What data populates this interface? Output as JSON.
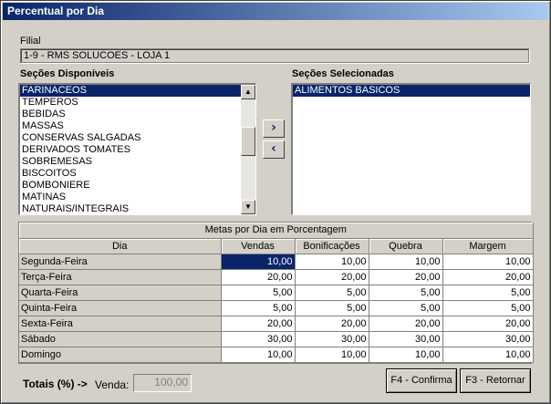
{
  "window": {
    "title": "Percentual por Dia"
  },
  "filial": {
    "label": "Filial",
    "value": "1-9 - RMS SOLUCOES - LOJA 1"
  },
  "secoes_disponiveis": {
    "label": "Seções Disponíveis",
    "items": [
      "FARINACEOS",
      "TEMPEROS",
      "BEBIDAS",
      "MASSAS",
      "CONSERVAS SALGADAS",
      "DERIVADOS TOMATES",
      "SOBREMESAS",
      "BISCOITOS",
      "BOMBONIERE",
      "MATINAS",
      "NATURAIS/INTEGRAIS"
    ],
    "selected_index": 0
  },
  "secoes_selecionadas": {
    "label": "Seções Selecionadas",
    "items": [
      "ALIMENTOS BASICOS"
    ],
    "selected_index": 0
  },
  "buttons": {
    "add": "›",
    "remove": "‹",
    "confirma": "F4 - Confirma",
    "retornar": "F3 - Retornar"
  },
  "grid": {
    "title": "Metas por Dia em Porcentagem",
    "columns": [
      "Dia",
      "Vendas",
      "Bonificações",
      "Quebra",
      "Margem"
    ],
    "rows": [
      {
        "dia": "Segunda-Feira",
        "vendas": "10,00",
        "bonif": "10,00",
        "quebra": "10,00",
        "margem": "10,00"
      },
      {
        "dia": "Terça-Feira",
        "vendas": "20,00",
        "bonif": "20,00",
        "quebra": "20,00",
        "margem": "20,00"
      },
      {
        "dia": "Quarta-Feira",
        "vendas": "5,00",
        "bonif": "5,00",
        "quebra": "5,00",
        "margem": "5,00"
      },
      {
        "dia": "Quinta-Feira",
        "vendas": "5,00",
        "bonif": "5,00",
        "quebra": "5,00",
        "margem": "5,00"
      },
      {
        "dia": "Sexta-Feira",
        "vendas": "20,00",
        "bonif": "20,00",
        "quebra": "20,00",
        "margem": "20,00"
      },
      {
        "dia": "Sábado",
        "vendas": "30,00",
        "bonif": "30,00",
        "quebra": "30,00",
        "margem": "30,00"
      },
      {
        "dia": "Domingo",
        "vendas": "10,00",
        "bonif": "10,00",
        "quebra": "10,00",
        "margem": "10,00"
      }
    ]
  },
  "totais": {
    "label": "Totais (%) ->",
    "venda_label": "Venda:",
    "venda_value": "100,00"
  }
}
